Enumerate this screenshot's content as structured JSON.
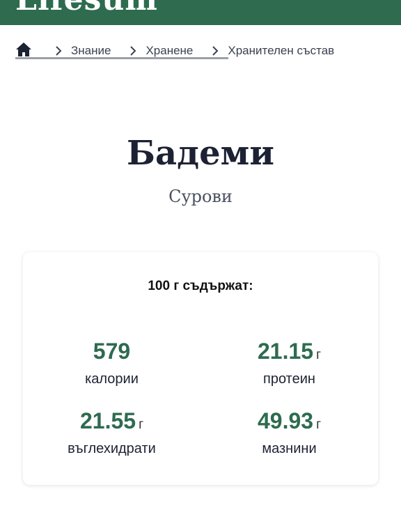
{
  "header": {
    "logo_text": "Lifesum",
    "background": "#2e6b4f"
  },
  "breadcrumb": {
    "home_icon": "home-icon",
    "separator_icon": "chevron-right-icon",
    "items": [
      "Знание",
      "Хранене",
      "Хранителен състав"
    ]
  },
  "food": {
    "name": "Бадеми",
    "variant": "Сурови"
  },
  "nutrition": {
    "heading": "100 г съдържат:",
    "stats": [
      {
        "value": "579",
        "unit": "",
        "label": "калории"
      },
      {
        "value": "21.15",
        "unit": "г",
        "label": "протеин"
      },
      {
        "value": "21.55",
        "unit": "г",
        "label": "въглехидрати"
      },
      {
        "value": "49.93",
        "unit": "г",
        "label": "мазнини"
      }
    ]
  },
  "colors": {
    "accent": "#2e6b4f",
    "title": "#1c2233"
  }
}
